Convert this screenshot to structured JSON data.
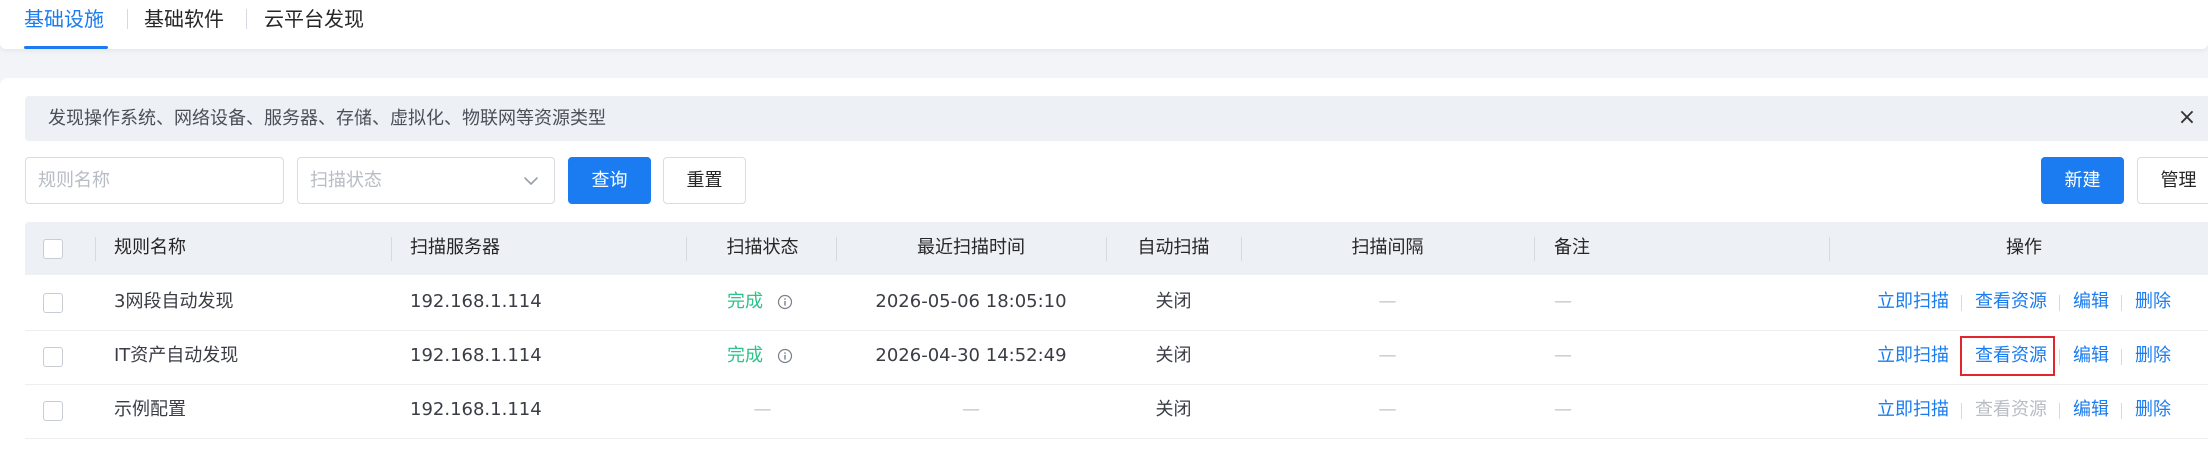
{
  "tabs": [
    {
      "label": "基础设施",
      "active": true
    },
    {
      "label": "基础软件",
      "active": false
    },
    {
      "label": "云平台发现",
      "active": false
    }
  ],
  "notice": {
    "text": "发现操作系统、网络设备、服务器、存储、虚拟化、物联网等资源类型",
    "close_icon": "×"
  },
  "filters": {
    "rule_name_placeholder": "规则名称",
    "scan_status_placeholder": "扫描状态",
    "query_label": "查询",
    "reset_label": "重置",
    "new_label": "新建",
    "manage_label": "管理"
  },
  "table": {
    "columns": [
      "规则名称",
      "扫描服务器",
      "扫描状态",
      "最近扫描时间",
      "自动扫描",
      "扫描间隔",
      "备注",
      "操作"
    ],
    "rows": [
      {
        "name": "3网段自动发现",
        "server": "192.168.1.114",
        "status": "完成",
        "last_scan": "2026-05-06 18:05:10",
        "auto_scan": "关闭",
        "interval": "—",
        "remark": "—",
        "actions": {
          "scan": "立即扫描",
          "view": "查看资源",
          "view_enabled": true,
          "edit": "编辑",
          "delete": "删除"
        }
      },
      {
        "name": "IT资产自动发现",
        "server": "192.168.1.114",
        "status": "完成",
        "last_scan": "2026-04-30 14:52:49",
        "auto_scan": "关闭",
        "interval": "—",
        "remark": "—",
        "actions": {
          "scan": "立即扫描",
          "view": "查看资源",
          "view_enabled": true,
          "edit": "编辑",
          "delete": "删除"
        }
      },
      {
        "name": "示例配置",
        "server": "192.168.1.114",
        "status": "—",
        "last_scan": "—",
        "auto_scan": "关闭",
        "interval": "—",
        "remark": "—",
        "actions": {
          "scan": "立即扫描",
          "view": "查看资源",
          "view_enabled": false,
          "edit": "编辑",
          "delete": "删除"
        }
      }
    ]
  },
  "colors": {
    "primary": "#1a7cf0",
    "success": "#2bc48a",
    "highlight": "#e1262d"
  }
}
